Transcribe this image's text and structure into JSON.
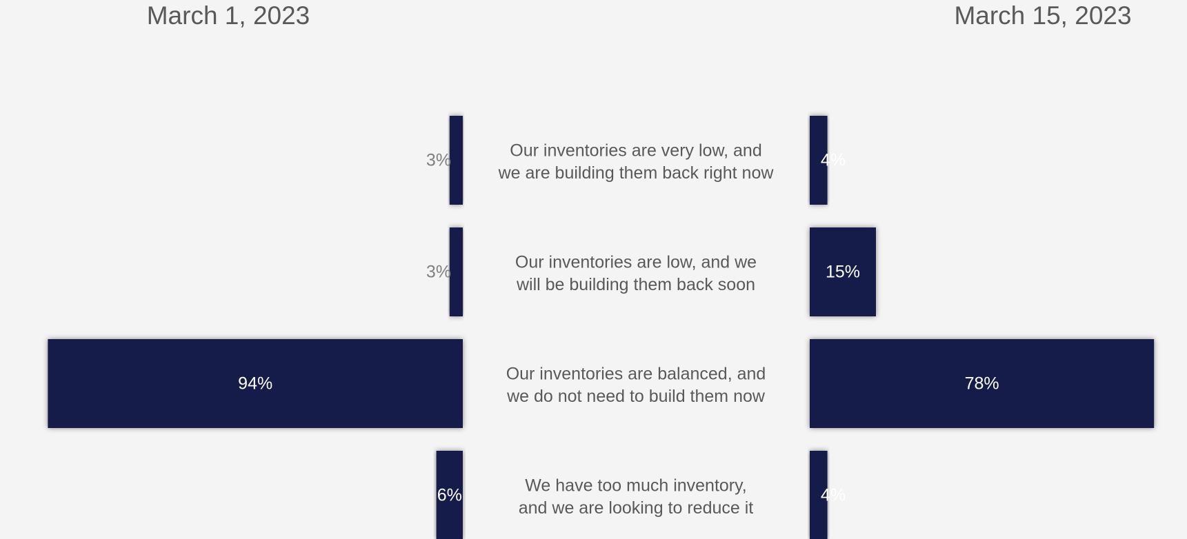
{
  "chart_data": {
    "type": "bar",
    "orientation": "horizontal",
    "layout": "back-to-back",
    "categories": [
      [
        "Our inventories are very low, and",
        "we are building them back right now"
      ],
      [
        "Our inventories are low, and we",
        "will be building them back soon"
      ],
      [
        "Our inventories are balanced, and",
        "we do not need to build them now"
      ],
      [
        "We have too much inventory,",
        "and we are looking to reduce it"
      ]
    ],
    "series": [
      {
        "name": "March 1, 2023",
        "side": "left",
        "values": [
          3,
          3,
          94,
          6
        ],
        "labels": [
          "3%",
          "3%",
          "94%",
          "6%"
        ]
      },
      {
        "name": "March 15, 2023",
        "side": "right",
        "values": [
          4,
          15,
          78,
          4
        ],
        "labels": [
          "4%",
          "15%",
          "78%",
          "4%"
        ]
      }
    ],
    "unit": "%",
    "xlim": [
      0,
      100
    ],
    "grid": false,
    "colors": {
      "bar": "#151b48",
      "label_inside": "#ffffff",
      "label_outside": "#7f7f7f",
      "category_text": "#595959",
      "background": "#f4f4f4"
    }
  }
}
